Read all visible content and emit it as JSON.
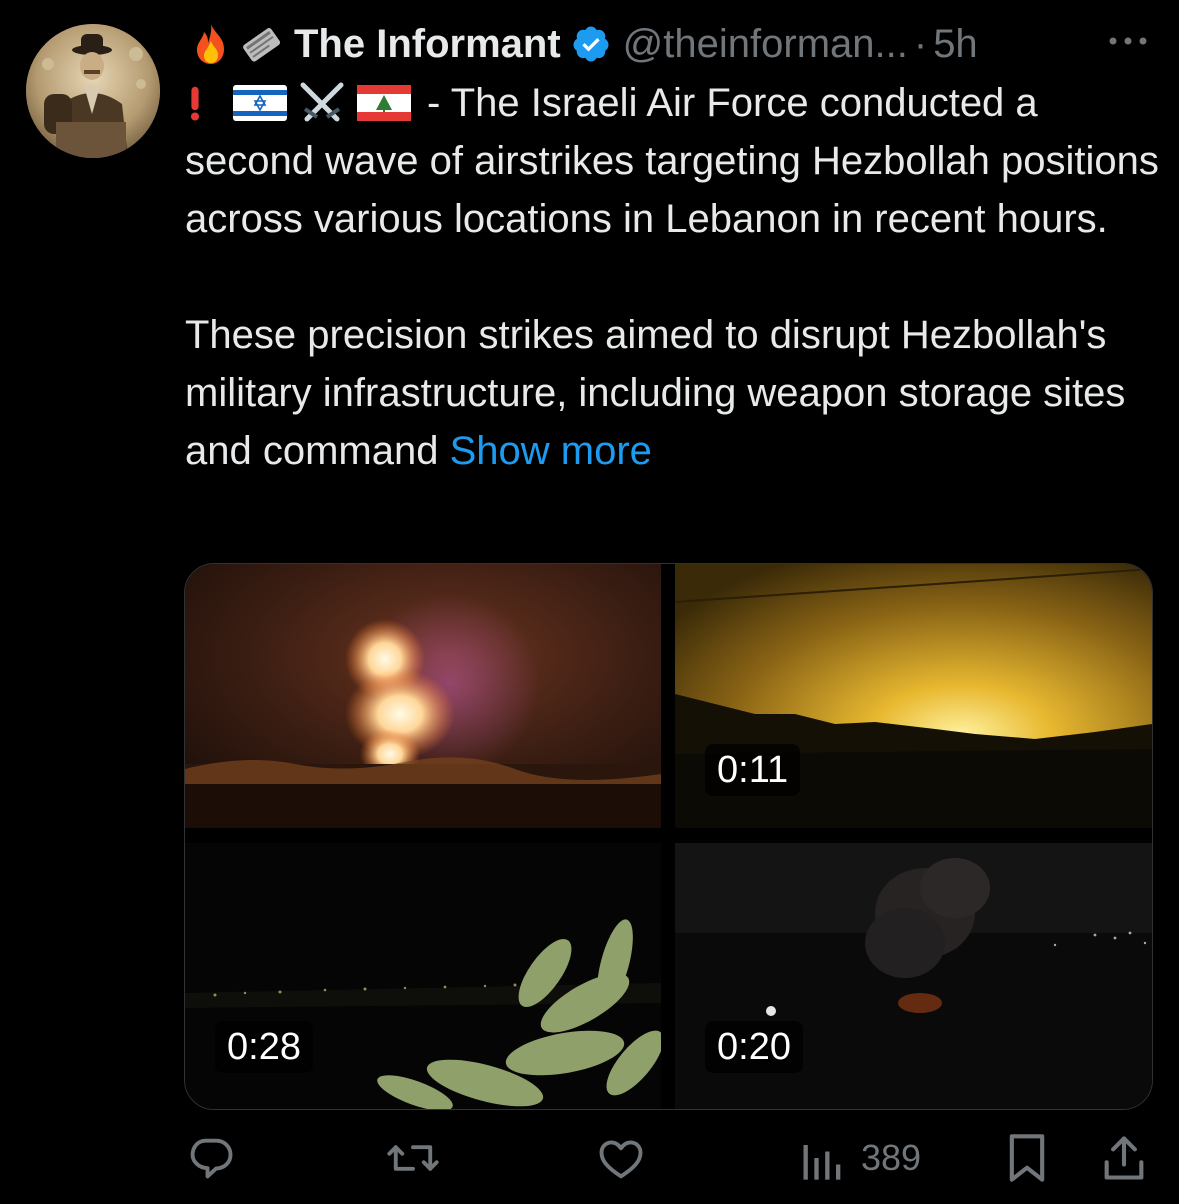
{
  "tweet": {
    "emoji_prefix": [
      "fire-emoji",
      "newspaper-emoji"
    ],
    "display_name": "The Informant",
    "handle": "@theinforman...",
    "separator": "·",
    "time": "5h",
    "line1_emoji": [
      "exclamation-emoji",
      "israel-flag-emoji",
      "crossed-swords-emoji",
      "lebanon-flag-emoji"
    ],
    "line1_text": "- The Israeli Air Force conducted a",
    "paragraph1_rest": "second wave of airstrikes targeting Hezbollah positions across various locations in Lebanon in recent hours.",
    "paragraph2": "These precision strikes aimed to disrupt Hezbollah's military infrastructure, including weapon storage sites and command",
    "show_more": "Show more"
  },
  "media": [
    {
      "kind": "image",
      "duration": ""
    },
    {
      "kind": "video",
      "duration": "0:11"
    },
    {
      "kind": "video",
      "duration": "0:28"
    },
    {
      "kind": "video",
      "duration": "0:20"
    }
  ],
  "actions": {
    "reply_count": "",
    "retweet_count": "",
    "like_count": "",
    "views_count": "389"
  },
  "colors": {
    "background": "#000000",
    "text": "#e7e9ea",
    "muted": "#71767b",
    "link": "#1d9bf0",
    "verified": "#1d9bf0"
  }
}
